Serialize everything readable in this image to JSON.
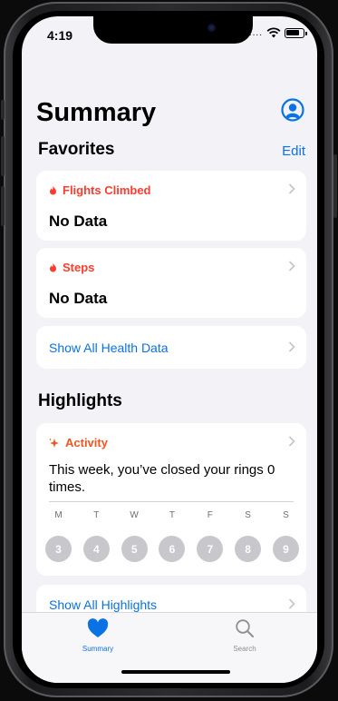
{
  "status": {
    "time": "4:19",
    "signal_dots": "...."
  },
  "header": {
    "title": "Summary",
    "avatar_icon": "person-circle-icon"
  },
  "favorites": {
    "heading": "Favorites",
    "edit_label": "Edit",
    "cards": [
      {
        "title": "Flights Climbed",
        "value": "No Data",
        "icon": "flame-icon"
      },
      {
        "title": "Steps",
        "value": "No Data",
        "icon": "flame-icon"
      }
    ],
    "show_all_label": "Show All Health Data"
  },
  "highlights": {
    "heading": "Highlights",
    "activity": {
      "title": "Activity",
      "icon": "sparkle-icon",
      "text": "This week, you’ve closed your rings 0 times.",
      "days": [
        "M",
        "T",
        "W",
        "T",
        "F",
        "S",
        "S"
      ],
      "dates": [
        "3",
        "4",
        "5",
        "6",
        "7",
        "8",
        "9"
      ]
    },
    "show_all_label": "Show All Highlights"
  },
  "tabbar": {
    "items": [
      {
        "label": "Summary",
        "icon": "heart-icon",
        "active": true
      },
      {
        "label": "Search",
        "icon": "search-icon",
        "active": false
      }
    ]
  },
  "colors": {
    "accent_blue": "#0a72e4",
    "favorite_red": "#ff3b30",
    "activity_orange": "#f2541e",
    "background": "#f2f2f7"
  }
}
